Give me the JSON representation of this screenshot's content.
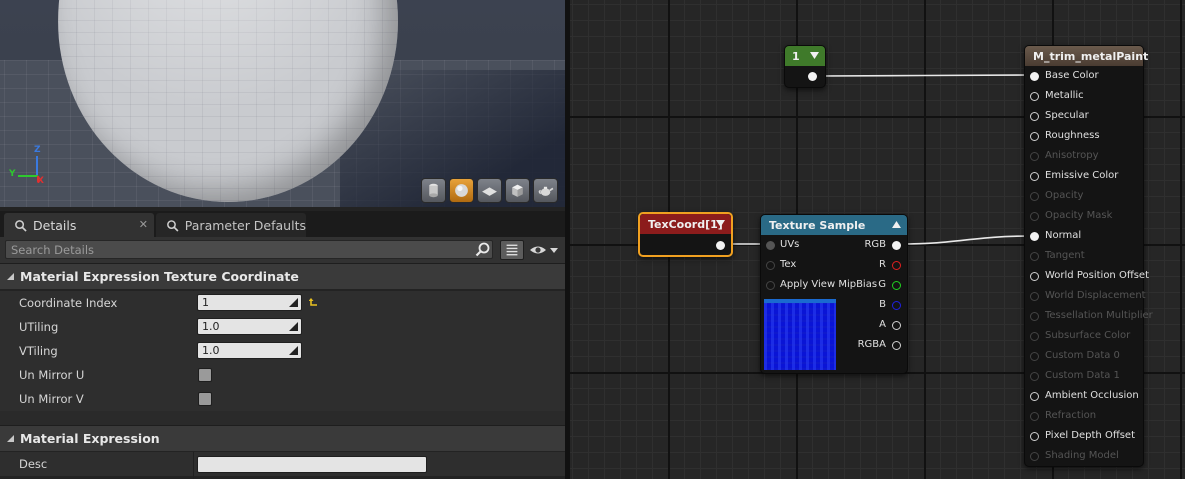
{
  "viewport": {
    "axes": {
      "z": "Z",
      "y": "Y",
      "x": "X"
    },
    "toolbar": [
      {
        "icon": "cylinder-preview-icon",
        "active": false
      },
      {
        "icon": "sphere-preview-icon",
        "active": true
      },
      {
        "icon": "plane-preview-icon",
        "active": false
      },
      {
        "icon": "cube-preview-icon",
        "active": false
      },
      {
        "icon": "teapot-preview-icon",
        "active": false
      }
    ]
  },
  "tabs": [
    {
      "label": "Details",
      "icon": "details-icon",
      "active": true
    },
    {
      "label": "Parameter Defaults",
      "icon": "parameter-defaults-icon",
      "active": false
    }
  ],
  "search": {
    "placeholder": "Search Details",
    "value": ""
  },
  "sections": {
    "texcoord": {
      "title": "Material Expression Texture Coordinate",
      "rows": {
        "coordinate_index": {
          "label": "Coordinate Index",
          "value": "1"
        },
        "utiling": {
          "label": "UTiling",
          "value": "1.0"
        },
        "vtiling": {
          "label": "VTiling",
          "value": "1.0"
        },
        "un_mirror_u": {
          "label": "Un Mirror U",
          "checked": false
        },
        "un_mirror_v": {
          "label": "Un Mirror V",
          "checked": false
        }
      }
    },
    "expression": {
      "title": "Material Expression",
      "rows": {
        "desc": {
          "label": "Desc",
          "value": ""
        }
      }
    }
  },
  "graph": {
    "constant_node": {
      "title": "1",
      "header_color": "#3f7a2a"
    },
    "texcoord_node": {
      "title": "TexCoord[1]",
      "header_color": "#8c1c1c",
      "selected_color": "#f0a020"
    },
    "texture_sample_node": {
      "title": "Texture Sample",
      "header_color": "#2a6a86",
      "inputs": [
        "UVs",
        "Tex",
        "Apply View MipBias"
      ],
      "outputs": [
        "RGB",
        "R",
        "G",
        "B",
        "A",
        "RGBA"
      ]
    },
    "material_node": {
      "title": "M_trim_metalPaint",
      "header_color": "#5a4a3e",
      "pins": [
        {
          "label": "Base Color",
          "state": "connected"
        },
        {
          "label": "Metallic",
          "state": "enabled"
        },
        {
          "label": "Specular",
          "state": "enabled"
        },
        {
          "label": "Roughness",
          "state": "enabled"
        },
        {
          "label": "Anisotropy",
          "state": "disabled"
        },
        {
          "label": "Emissive Color",
          "state": "enabled"
        },
        {
          "label": "Opacity",
          "state": "disabled"
        },
        {
          "label": "Opacity Mask",
          "state": "disabled"
        },
        {
          "label": "Normal",
          "state": "connected"
        },
        {
          "label": "Tangent",
          "state": "disabled"
        },
        {
          "label": "World Position Offset",
          "state": "enabled"
        },
        {
          "label": "World Displacement",
          "state": "disabled"
        },
        {
          "label": "Tessellation Multiplier",
          "state": "disabled"
        },
        {
          "label": "Subsurface Color",
          "state": "disabled"
        },
        {
          "label": "Custom Data 0",
          "state": "disabled"
        },
        {
          "label": "Custom Data 1",
          "state": "disabled"
        },
        {
          "label": "Ambient Occlusion",
          "state": "enabled"
        },
        {
          "label": "Refraction",
          "state": "disabled"
        },
        {
          "label": "Pixel Depth Offset",
          "state": "enabled"
        },
        {
          "label": "Shading Model",
          "state": "disabled"
        }
      ]
    }
  }
}
